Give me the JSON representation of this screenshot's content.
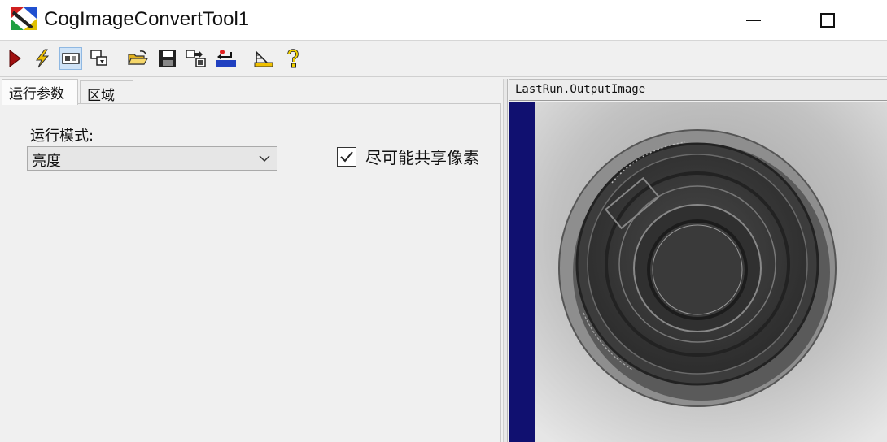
{
  "window": {
    "title": "CogImageConvertTool1",
    "icon": "cognex-app-icon"
  },
  "toolbar": {
    "buttons": [
      {
        "name": "run-icon",
        "color": "#a01010"
      },
      {
        "name": "lightning-icon",
        "color": "#f0c000"
      },
      {
        "name": "show-panel-icon",
        "active": true
      },
      {
        "name": "tool-window-icon"
      },
      {
        "name": "open-folder-icon",
        "color": "#e0b020"
      },
      {
        "name": "save-icon"
      },
      {
        "name": "export-icon"
      },
      {
        "name": "reset-icon",
        "color": "#2040c0"
      },
      {
        "name": "calibrate-icon"
      },
      {
        "name": "help-icon",
        "color": "#e0c000"
      }
    ]
  },
  "tabs": [
    {
      "label": "运行参数",
      "active": true
    },
    {
      "label": "区域",
      "active": false
    }
  ],
  "params": {
    "mode_label": "运行模式:",
    "mode_value": "亮度",
    "share_pixels_label": "尽可能共享像素",
    "share_pixels_checked": true
  },
  "display": {
    "title": "LastRun.OutputImage",
    "strip_color": "#101070"
  }
}
